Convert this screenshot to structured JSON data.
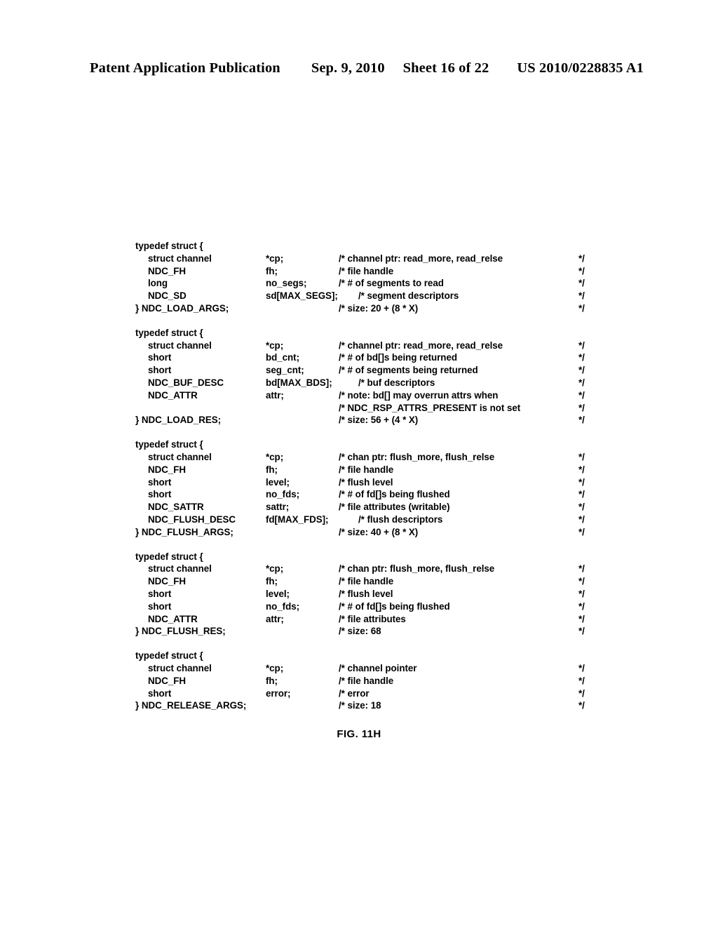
{
  "header": {
    "title": "Patent Application Publication",
    "date": "Sep. 9, 2010",
    "sheet": "Sheet 16 of 22",
    "doc_number": "US 2010/0228835 A1"
  },
  "figure": {
    "caption": "FIG. 11H"
  },
  "code": {
    "comment_end": "*/",
    "blocks": [
      {
        "open": "typedef struct {",
        "close": "} NDC_LOAD_ARGS;",
        "members": [
          {
            "type": "struct channel",
            "field": "*cp;",
            "comment": "/* channel ptr: read_more, read_relse"
          },
          {
            "type": "NDC_FH",
            "field": "fh;",
            "comment": "/* file handle"
          },
          {
            "type": "long",
            "field": "no_segs;",
            "comment": "/* # of segments to read"
          },
          {
            "type": "NDC_SD",
            "field": "sd[MAX_SEGS];",
            "comment": "/*  segment descriptors"
          }
        ],
        "size_comment": "/* size: 20 + (8 * X)"
      },
      {
        "open": "typedef struct {",
        "close": "} NDC_LOAD_RES;",
        "members": [
          {
            "type": "struct channel",
            "field": "*cp;",
            "comment": "/* channel ptr: read_more, read_relse"
          },
          {
            "type": "short",
            "field": "bd_cnt;",
            "comment": "/* # of bd[]s being returned"
          },
          {
            "type": "short",
            "field": "seg_cnt;",
            "comment": "/* # of segments being returned"
          },
          {
            "type": "NDC_BUF_DESC",
            "field": "bd[MAX_BDS];",
            "comment": "/* buf descriptors"
          },
          {
            "type": "NDC_ATTR",
            "field": "attr;",
            "comment": "/* note: bd[] may overrun attrs when"
          },
          {
            "type": "",
            "field": "",
            "comment": "/*  NDC_RSP_ATTRS_PRESENT is not set"
          }
        ],
        "size_comment": "/* size: 56 + (4 * X)"
      },
      {
        "open": "typedef struct {",
        "close": "} NDC_FLUSH_ARGS;",
        "members": [
          {
            "type": "struct channel",
            "field": "*cp;",
            "comment": "/* chan ptr: flush_more, flush_relse"
          },
          {
            "type": "NDC_FH",
            "field": "fh;",
            "comment": "/* file handle"
          },
          {
            "type": "short",
            "field": "level;",
            "comment": "/* flush level"
          },
          {
            "type": "short",
            "field": "no_fds;",
            "comment": "/* # of fd[]s being flushed"
          },
          {
            "type": "NDC_SATTR",
            "field": "sattr;",
            "comment": "/* file attributes (writable)"
          },
          {
            "type": "NDC_FLUSH_DESC",
            "field": "fd[MAX_FDS];",
            "comment": "/* flush descriptors"
          }
        ],
        "size_comment": "/* size: 40 + (8 * X)"
      },
      {
        "open": "typedef struct {",
        "close": "} NDC_FLUSH_RES;",
        "members": [
          {
            "type": "struct channel",
            "field": "*cp;",
            "comment": "/* chan ptr: flush_more, flush_relse"
          },
          {
            "type": "NDC_FH",
            "field": "fh;",
            "comment": "/* file handle"
          },
          {
            "type": "short",
            "field": "level;",
            "comment": "/* flush level"
          },
          {
            "type": "short",
            "field": "no_fds;",
            "comment": "/* # of fd[]s being flushed"
          },
          {
            "type": "NDC_ATTR",
            "field": "attr;",
            "comment": "/* file attributes"
          }
        ],
        "size_comment": "/* size: 68"
      },
      {
        "open": "typedef struct {",
        "close": "} NDC_RELEASE_ARGS;",
        "members": [
          {
            "type": "struct channel",
            "field": "*cp;",
            "comment": "/* channel pointer"
          },
          {
            "type": "NDC_FH",
            "field": "fh;",
            "comment": "/* file handle"
          },
          {
            "type": "short",
            "field": "error;",
            "comment": "/* error"
          }
        ],
        "size_comment": "/* size: 18"
      }
    ]
  }
}
